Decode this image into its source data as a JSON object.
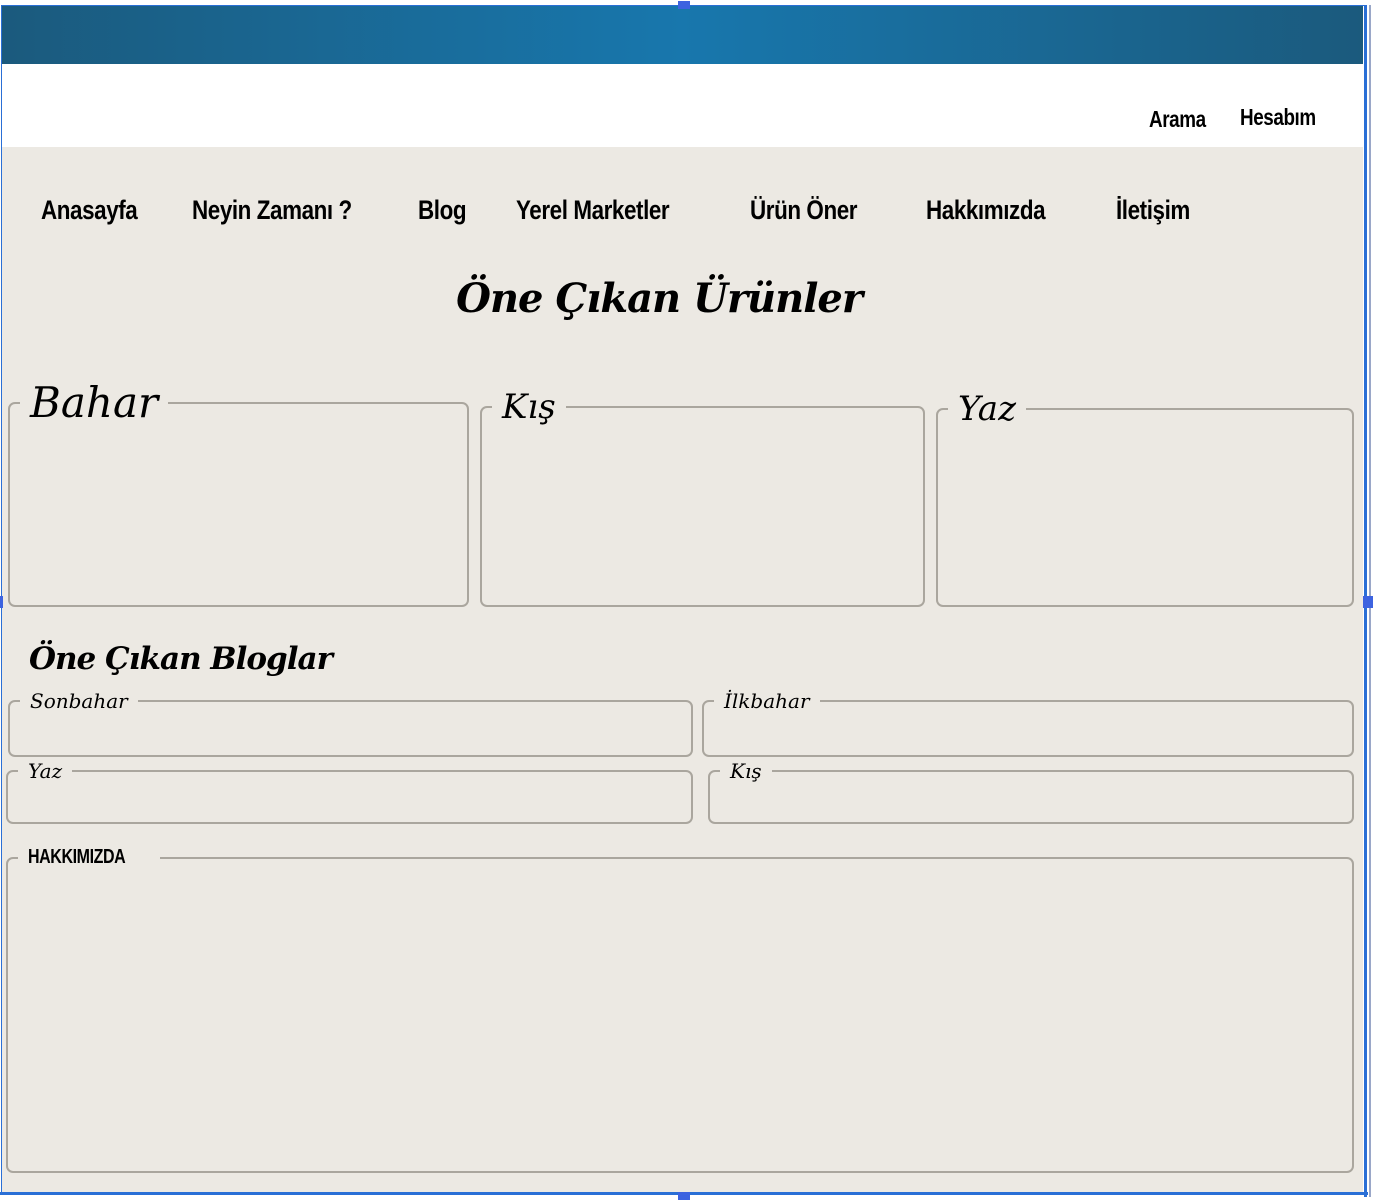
{
  "top_links": {
    "search": "Arama",
    "account": "Hesabım"
  },
  "nav": [
    {
      "label": "Anasayfa"
    },
    {
      "label": "Neyin Zamanı ?"
    },
    {
      "label": "Blog"
    },
    {
      "label": "Yerel Marketler"
    },
    {
      "label": "Ürün Öner"
    },
    {
      "label": "Hakkımızda"
    },
    {
      "label": "İletişim"
    }
  ],
  "featured_products": {
    "title": "Öne Çıkan Ürünler",
    "boxes": [
      {
        "label": "Bahar"
      },
      {
        "label": "Kış"
      },
      {
        "label": "Yaz"
      }
    ]
  },
  "featured_blogs": {
    "title": "Öne Çıkan Bloglar",
    "boxes": [
      {
        "label": "Sonbahar"
      },
      {
        "label": "İlkbahar"
      },
      {
        "label": "Yaz"
      },
      {
        "label": "Kış"
      }
    ]
  },
  "about": {
    "label": "HAKKIMIZDA"
  },
  "colors": {
    "header": "#1877ad",
    "content_bg": "#ece9e3",
    "border": "#aaa69e",
    "selection": "#2a6fd6"
  }
}
